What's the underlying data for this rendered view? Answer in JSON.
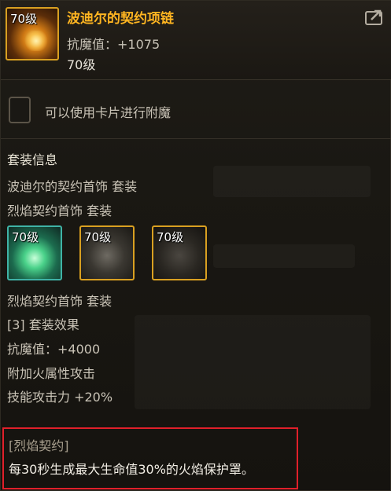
{
  "item": {
    "level_tag": "70级",
    "name": "波迪尔的契约项链",
    "stat": "抗魔值：+1075",
    "level": "70级"
  },
  "enchant": {
    "label": "可以使用卡片进行附魔"
  },
  "set_info": {
    "title": "套装信息",
    "lines": [
      "波迪尔的契约首饰 套装",
      "烈焰契约首饰 套装"
    ],
    "slots": [
      {
        "level": "70级",
        "border": "#3fb3a6"
      },
      {
        "level": "70级",
        "border": "#d9a021"
      },
      {
        "level": "70级",
        "border": "#d9a021"
      }
    ],
    "set_name": "烈焰契约首饰 套装",
    "bonus_header": "[3] 套装效果",
    "bonus_lines": [
      "抗魔值：+4000",
      "附加火属性攻击",
      "技能攻击力 +20%"
    ]
  },
  "effect": {
    "name": "[烈焰契约]",
    "description": "每30秒生成最大生命值30%的火焰保护罩。"
  },
  "colors": {
    "name": "#ffb521",
    "highlight_border": "#e0202a",
    "slot_gold": "#d9a021",
    "slot_teal": "#3fb3a6"
  },
  "icons": {
    "share": "share-icon"
  }
}
